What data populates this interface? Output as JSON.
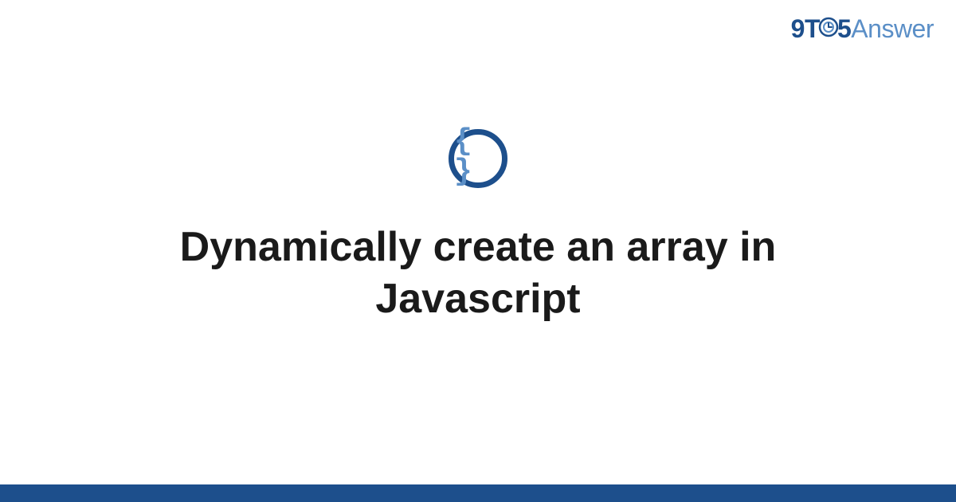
{
  "logo": {
    "part1": "9",
    "part2": "T",
    "part3": "5",
    "part4": "Answer"
  },
  "icon": {
    "braces": "{ }"
  },
  "title": "Dynamically create an array in Javascript",
  "colors": {
    "primary": "#1d4f8c",
    "secondary": "#5b8fc7"
  }
}
